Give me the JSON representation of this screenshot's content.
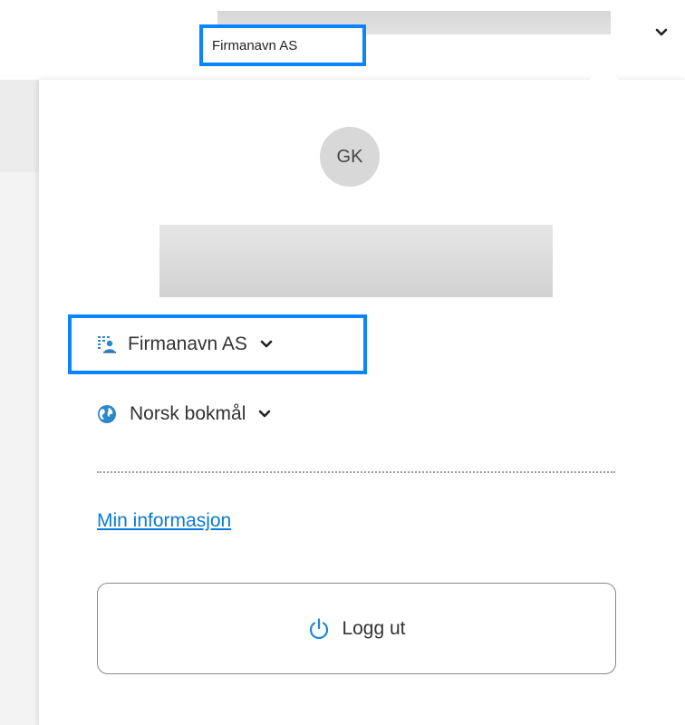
{
  "header": {
    "company_name": "Firmanavn AS",
    "menu_icon": "chevron-down-icon"
  },
  "profile": {
    "initials": "GK"
  },
  "organization": {
    "selected": "Firmanavn AS",
    "icon": "organization-icon"
  },
  "language": {
    "selected": "Norsk bokmål",
    "icon": "globe-icon"
  },
  "links": {
    "my_info": "Min informasjon"
  },
  "logout": {
    "label": "Logg ut",
    "icon": "power-icon"
  },
  "colors": {
    "highlight": "#0a84ff",
    "link": "#0a7bd0",
    "avatar_bg": "#d8d8d8"
  }
}
